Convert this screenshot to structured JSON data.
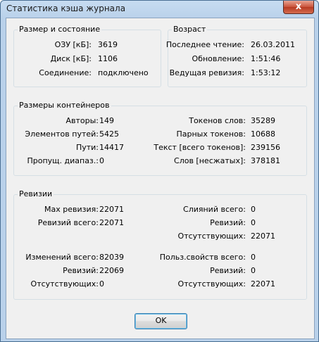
{
  "window": {
    "title": "Статистика кэша журнала",
    "close_label": "x"
  },
  "size_state": {
    "title": "Размер и состояние",
    "ram_label": "ОЗУ [кБ]:",
    "ram_value": "3619",
    "disk_label": "Диск [кБ]:",
    "disk_value": "1106",
    "conn_label": "Соединение:",
    "conn_value": "подключено"
  },
  "age": {
    "title": "Возраст",
    "last_read_label": "Последнее чтение:",
    "last_read_value": "26.03.2011",
    "update_label": "Обновление:",
    "update_value": "1:51:46",
    "head_rev_label": "Ведущая ревизия:",
    "head_rev_value": "1:53:12"
  },
  "containers": {
    "title": "Размеры контейнеров",
    "authors_label": "Авторы:",
    "authors_value": "149",
    "path_elems_label": "Элементов путей:",
    "path_elems_value": "5425",
    "paths_label": "Пути:",
    "paths_value": "14417",
    "skipped_label": "Пропущ. диапаз.:",
    "skipped_value": "0",
    "word_tokens_label": "Токенов слов:",
    "word_tokens_value": "35289",
    "pair_tokens_label": "Парных токенов:",
    "pair_tokens_value": "10688",
    "text_label": "Текст [всего токенов]:",
    "text_value": "239156",
    "words_label": "Слов [несжатых]:",
    "words_value": "378181"
  },
  "revisions": {
    "title": "Ревизии",
    "max_rev_label": "Max ревизия:",
    "max_rev_value": "22071",
    "rev_total_label": "Ревизий всего:",
    "rev_total_value": "22071",
    "merges_total_label": "Слияний всего:",
    "merges_total_value": "0",
    "merges_rev_label": "Ревизий:",
    "merges_rev_value": "0",
    "merges_missing_label": "Отсутствующих:",
    "merges_missing_value": "22071",
    "changes_total_label": "Изменений всего:",
    "changes_total_value": "82039",
    "changes_rev_label": "Ревизий:",
    "changes_rev_value": "22069",
    "changes_missing_label": "Отсутствующих:",
    "changes_missing_value": "0",
    "props_total_label": "Польз.свойств всего:",
    "props_total_value": "0",
    "props_rev_label": "Ревизий:",
    "props_rev_value": "0",
    "props_missing_label": "Отсутствующих:",
    "props_missing_value": "22071"
  },
  "buttons": {
    "ok_label": "OK"
  }
}
